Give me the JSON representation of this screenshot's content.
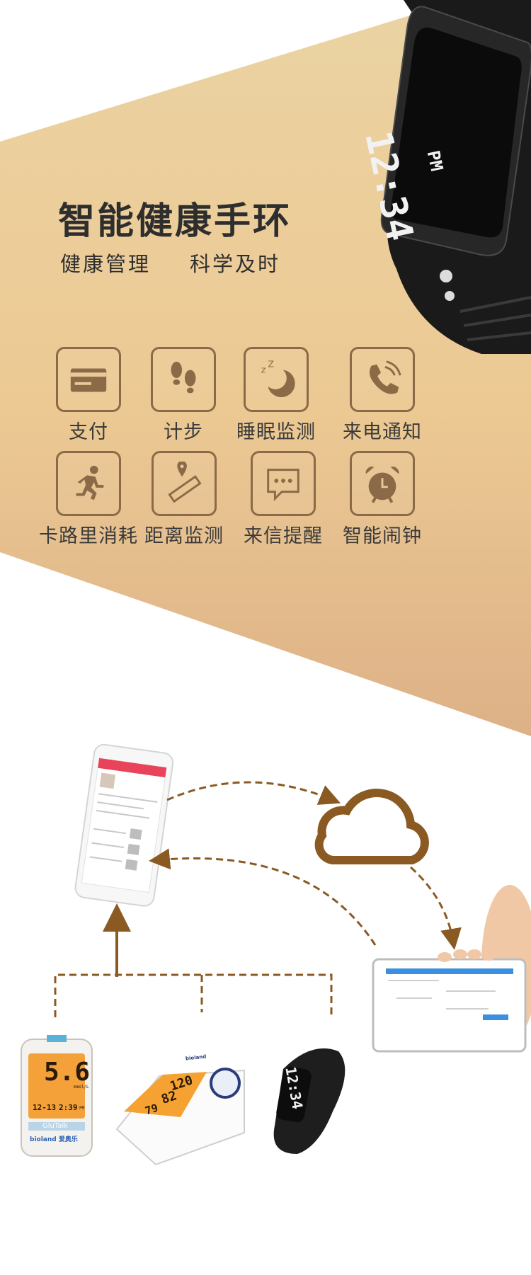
{
  "title": "智能健康手环",
  "subtitle_left": "健康管理",
  "subtitle_right": "科学及时",
  "watch_time": "12:34",
  "watch_ampm": "PM",
  "features": [
    {
      "label": "支付",
      "icon": "card-icon"
    },
    {
      "label": "计步",
      "icon": "footprints-icon"
    },
    {
      "label": "睡眠监测",
      "icon": "moon-sleep-icon"
    },
    {
      "label": "来电通知",
      "icon": "phone-call-icon"
    },
    {
      "label": "卡路里消耗",
      "icon": "running-icon"
    },
    {
      "label": "距离监测",
      "icon": "ruler-location-icon"
    },
    {
      "label": "来信提醒",
      "icon": "message-icon"
    },
    {
      "label": "智能闹钟",
      "icon": "alarm-clock-icon"
    }
  ],
  "glucometer": {
    "value": "5.6",
    "unit": "mmol/L",
    "date": "12-13",
    "time": "2:39",
    "ampm": "PM",
    "brand": "GluTalk",
    "maker": "bioland 爱奥乐"
  },
  "bp_monitor": {
    "sys": "120",
    "dia": "82",
    "pulse": "79",
    "brand": "bioland"
  },
  "band_time": "12:34",
  "colors": {
    "accent": "#8b5a22",
    "icon_border": "#8b6a47",
    "banner_light": "#f0d5a8",
    "banner_dark": "#e1b486",
    "text": "#2e2e2e"
  }
}
